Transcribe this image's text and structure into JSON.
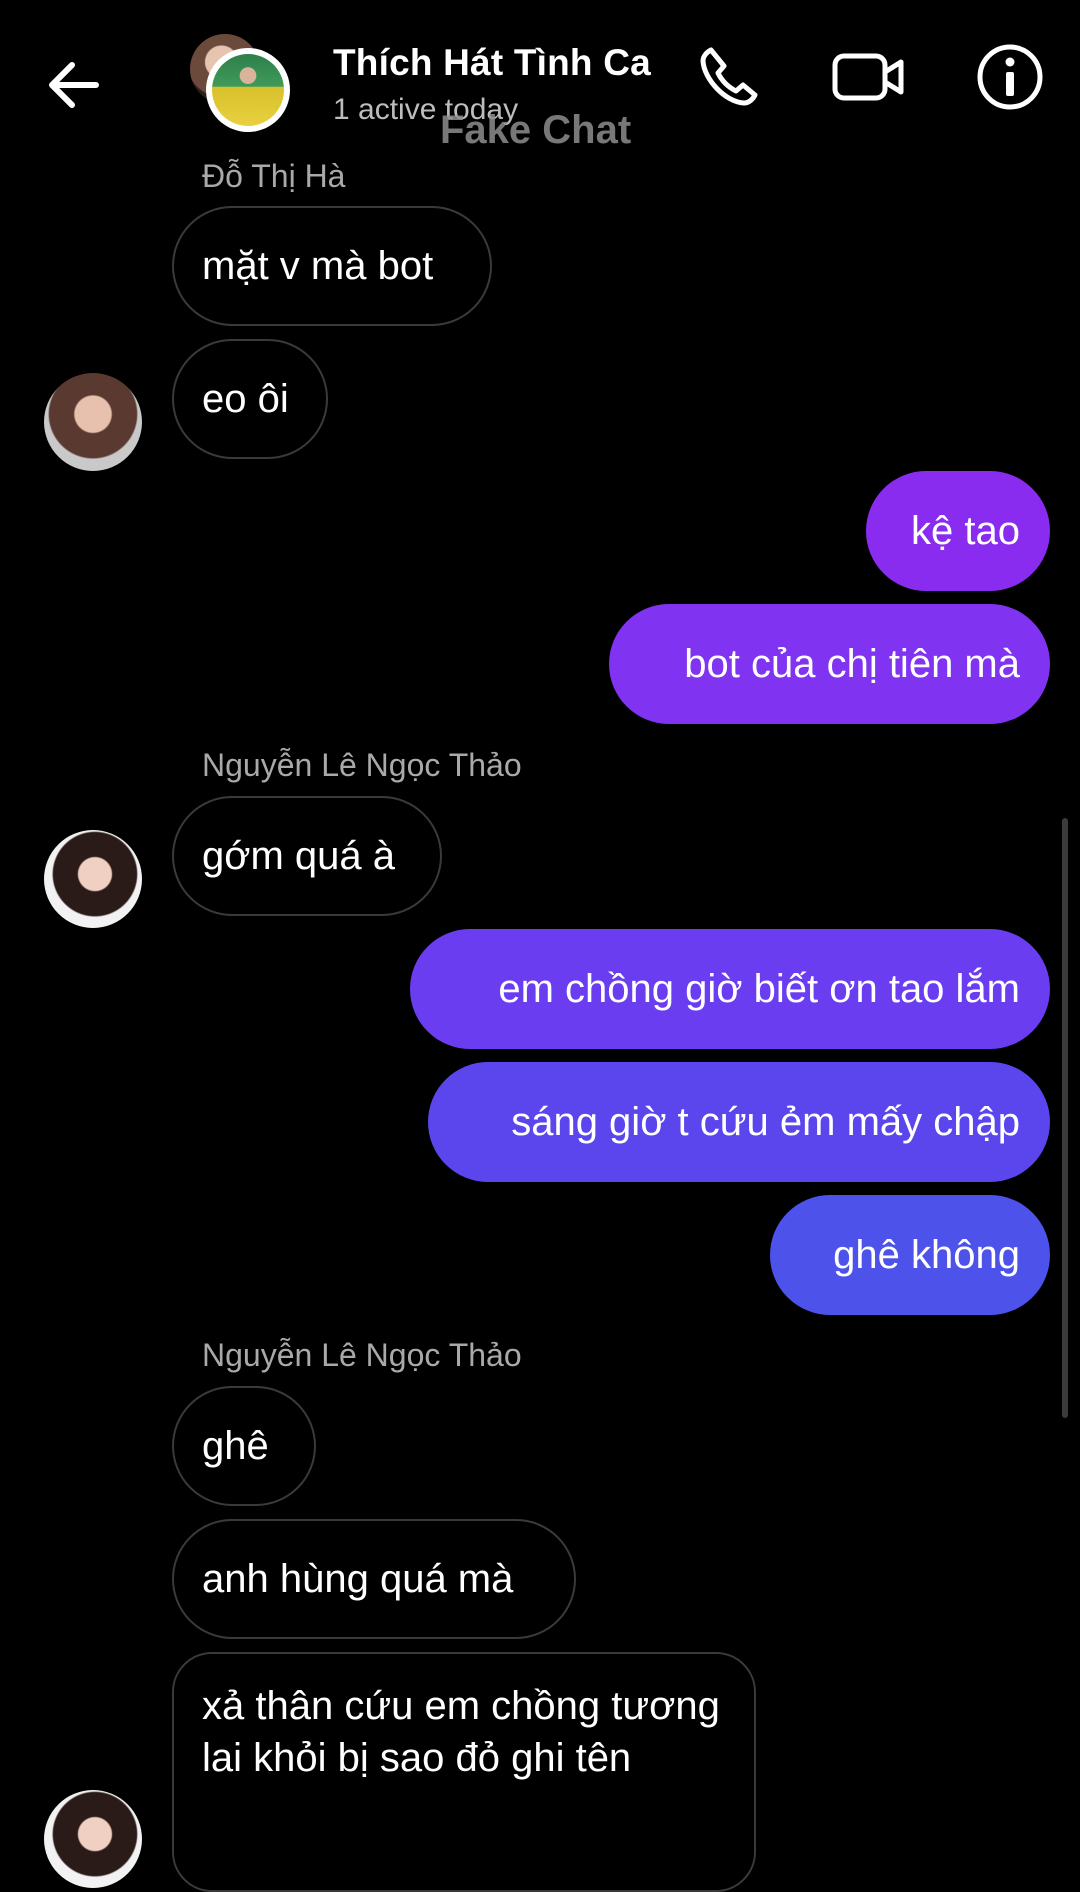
{
  "header": {
    "title": "Thích Hát Tình Ca",
    "status": "1 active today",
    "watermark": "Fake Chat",
    "icons": [
      "back-arrow-icon",
      "phone-icon",
      "video-camera-icon",
      "info-icon"
    ]
  },
  "messages": [
    {
      "sender": "Đỗ Thị Hà",
      "text": "mặt v mà bot",
      "direction": "in"
    },
    {
      "text": "eo ôi",
      "direction": "in"
    },
    {
      "text": "kệ tao",
      "direction": "out"
    },
    {
      "text": "bot của chị tiên mà",
      "direction": "out"
    },
    {
      "sender": "Nguyễn Lê Ngọc Thảo",
      "text": "gớm quá à",
      "direction": "in"
    },
    {
      "text": "em chồng giờ biết ơn tao lắm",
      "direction": "out"
    },
    {
      "text": "sáng giờ t cứu ẻm mấy chập",
      "direction": "out"
    },
    {
      "text": "ghê không",
      "direction": "out"
    },
    {
      "sender": "Nguyễn Lê Ngọc Thảo",
      "text": "ghê",
      "direction": "in"
    },
    {
      "text": "anh hùng quá mà",
      "direction": "in"
    },
    {
      "text": "xả thân cứu em chồng tương lai khỏi bị sao đỏ ghi tên",
      "direction": "in"
    }
  ],
  "colors": {
    "background": "#000000",
    "outgoing_purple": "#8a2cf0",
    "outgoing_violet": "#6a3df0",
    "outgoing_blue": "#4d52ea",
    "incoming_border": "#3a3a3a"
  }
}
